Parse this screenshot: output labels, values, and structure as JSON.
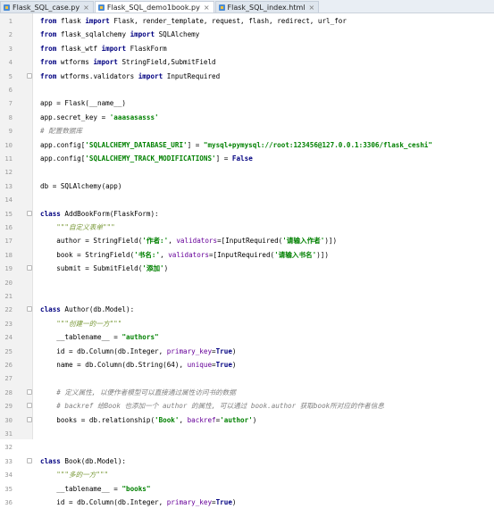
{
  "tabs": [
    {
      "label": "Flask_SQL_case.py",
      "active": false
    },
    {
      "label": "Flask_SQL_demo1book.py",
      "active": true
    },
    {
      "label": "Flask_SQL_index.html",
      "active": false
    }
  ],
  "code_lines": [
    {
      "n": "1",
      "fold": false,
      "segs": [
        [
          "kw",
          "from"
        ],
        [
          "plain",
          " flask "
        ],
        [
          "kw",
          "import"
        ],
        [
          "plain",
          " Flask, render_template, request, flash, redirect, url_for"
        ]
      ]
    },
    {
      "n": "2",
      "fold": false,
      "segs": [
        [
          "kw",
          "from"
        ],
        [
          "plain",
          " flask_sqlalchemy "
        ],
        [
          "kw",
          "import"
        ],
        [
          "plain",
          " SQLAlchemy"
        ]
      ]
    },
    {
      "n": "3",
      "fold": false,
      "segs": [
        [
          "kw",
          "from"
        ],
        [
          "plain",
          " flask_wtf "
        ],
        [
          "kw",
          "import"
        ],
        [
          "plain",
          " FlaskForm"
        ]
      ]
    },
    {
      "n": "4",
      "fold": false,
      "segs": [
        [
          "kw",
          "from"
        ],
        [
          "plain",
          " wtforms "
        ],
        [
          "kw",
          "import"
        ],
        [
          "plain",
          " StringField,SubmitField"
        ]
      ]
    },
    {
      "n": "5",
      "fold": true,
      "segs": [
        [
          "kw",
          "from"
        ],
        [
          "plain",
          " wtforms.validators "
        ],
        [
          "kw",
          "import"
        ],
        [
          "plain",
          " InputRequired"
        ]
      ]
    },
    {
      "n": "6",
      "fold": false,
      "segs": []
    },
    {
      "n": "7",
      "fold": false,
      "segs": [
        [
          "plain",
          "app = Flask(__name__)"
        ]
      ]
    },
    {
      "n": "8",
      "fold": false,
      "segs": [
        [
          "plain",
          "app.secret_key = "
        ],
        [
          "str",
          "'aaasasasss'"
        ]
      ]
    },
    {
      "n": "9",
      "fold": false,
      "segs": [
        [
          "cmt",
          "# 配置数据库"
        ]
      ]
    },
    {
      "n": "10",
      "fold": false,
      "segs": [
        [
          "plain",
          "app.config["
        ],
        [
          "str",
          "'SQLALCHEMY_DATABASE_URI'"
        ],
        [
          "plain",
          "] = "
        ],
        [
          "str",
          "\"mysql+pymysql://root:123456@127.0.0.1:3306/flask_ceshi\""
        ]
      ]
    },
    {
      "n": "11",
      "fold": false,
      "segs": [
        [
          "plain",
          "app.config["
        ],
        [
          "str",
          "'SQLALCHEMY_TRACK_MODIFICATIONS'"
        ],
        [
          "plain",
          "] = "
        ],
        [
          "kw",
          "False"
        ]
      ]
    },
    {
      "n": "12",
      "fold": false,
      "segs": []
    },
    {
      "n": "13",
      "fold": false,
      "segs": [
        [
          "plain",
          "db = SQLAlchemy(app)"
        ]
      ]
    },
    {
      "n": "14",
      "fold": false,
      "segs": []
    },
    {
      "n": "15",
      "fold": true,
      "segs": [
        [
          "kw",
          "class"
        ],
        [
          "plain",
          " AddBookForm(FlaskForm):"
        ]
      ]
    },
    {
      "n": "16",
      "fold": false,
      "segs": [
        [
          "doc",
          "    \"\"\"自定义表单\"\"\""
        ]
      ]
    },
    {
      "n": "17",
      "fold": false,
      "segs": [
        [
          "plain",
          "    author = StringField("
        ],
        [
          "str",
          "'作者:'"
        ],
        [
          "plain",
          ", "
        ],
        [
          "kwa",
          "validators"
        ],
        [
          "plain",
          "=[InputRequired("
        ],
        [
          "str",
          "'请输入作者'"
        ],
        [
          "plain",
          ")])"
        ]
      ]
    },
    {
      "n": "18",
      "fold": false,
      "segs": [
        [
          "plain",
          "    book = StringField("
        ],
        [
          "str",
          "'书名:'"
        ],
        [
          "plain",
          ", "
        ],
        [
          "kwa",
          "validators"
        ],
        [
          "plain",
          "=[InputRequired("
        ],
        [
          "str",
          "'请输入书名'"
        ],
        [
          "plain",
          ")])"
        ]
      ]
    },
    {
      "n": "19",
      "fold": true,
      "segs": [
        [
          "plain",
          "    submit = SubmitField("
        ],
        [
          "str",
          "'添加'"
        ],
        [
          "plain",
          ")"
        ]
      ]
    },
    {
      "n": "20",
      "fold": false,
      "segs": []
    },
    {
      "n": "21",
      "fold": false,
      "segs": []
    },
    {
      "n": "22",
      "fold": true,
      "segs": [
        [
          "kw",
          "class"
        ],
        [
          "plain",
          " Author(db.Model):"
        ]
      ]
    },
    {
      "n": "23",
      "fold": false,
      "segs": [
        [
          "doc",
          "    \"\"\"创建一的一方\"\"\""
        ]
      ]
    },
    {
      "n": "24",
      "fold": false,
      "segs": [
        [
          "plain",
          "    __tablename__ = "
        ],
        [
          "str",
          "\"authors\""
        ]
      ]
    },
    {
      "n": "25",
      "fold": false,
      "segs": [
        [
          "plain",
          "    id = db.Column(db.Integer, "
        ],
        [
          "kwa",
          "primary_key"
        ],
        [
          "plain",
          "="
        ],
        [
          "kw",
          "True"
        ],
        [
          "plain",
          ")"
        ]
      ]
    },
    {
      "n": "26",
      "fold": false,
      "segs": [
        [
          "plain",
          "    name = db.Column(db.String(64), "
        ],
        [
          "kwa",
          "unique"
        ],
        [
          "plain",
          "="
        ],
        [
          "kw",
          "True"
        ],
        [
          "plain",
          ")"
        ]
      ]
    },
    {
      "n": "27",
      "fold": false,
      "segs": []
    },
    {
      "n": "28",
      "fold": true,
      "segs": [
        [
          "cmt",
          "    # 定义属性, 以便作者模型可以直接通过属性访问书的数据"
        ]
      ]
    },
    {
      "n": "29",
      "fold": true,
      "segs": [
        [
          "cmt",
          "    # backref 给Book 也添加一个 author 的属性, 可以通过 book.author 获取book所对应的作者信息"
        ]
      ]
    },
    {
      "n": "30",
      "fold": true,
      "segs": [
        [
          "plain",
          "    books = db.relationship("
        ],
        [
          "str",
          "'Book'"
        ],
        [
          "plain",
          ", "
        ],
        [
          "kwa",
          "backref"
        ],
        [
          "plain",
          "="
        ],
        [
          "str",
          "'author'"
        ],
        [
          "plain",
          ")"
        ]
      ]
    },
    {
      "n": "31",
      "fold": false,
      "segs": []
    },
    {
      "n": "32",
      "fold": false,
      "segs": []
    },
    {
      "n": "33",
      "fold": true,
      "segs": [
        [
          "kw",
          "class"
        ],
        [
          "plain",
          " Book(db.Model):"
        ]
      ]
    },
    {
      "n": "34",
      "fold": false,
      "segs": [
        [
          "doc",
          "    \"\"\"多的一方\"\"\""
        ]
      ]
    },
    {
      "n": "35",
      "fold": false,
      "segs": [
        [
          "plain",
          "    __tablename__ = "
        ],
        [
          "str",
          "\"books\""
        ]
      ]
    },
    {
      "n": "36",
      "fold": false,
      "segs": [
        [
          "plain",
          "    id = db.Column(db.Integer, "
        ],
        [
          "kwa",
          "primary_key"
        ],
        [
          "plain",
          "="
        ],
        [
          "kw",
          "True"
        ],
        [
          "plain",
          ")"
        ]
      ]
    }
  ]
}
